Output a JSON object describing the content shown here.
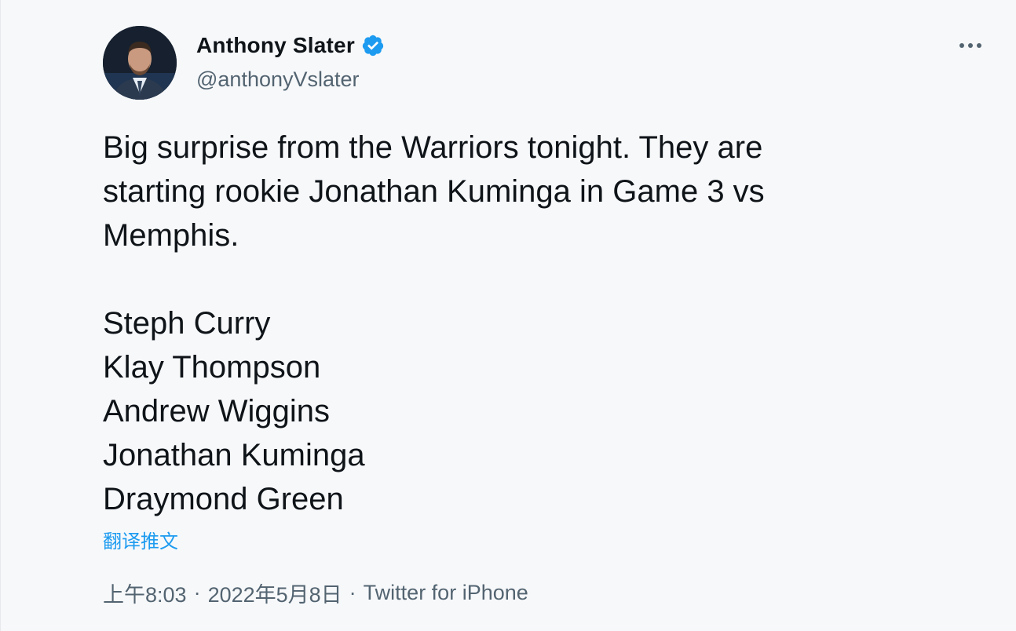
{
  "author": {
    "display_name": "Anthony Slater",
    "handle": "@anthonyVslater",
    "verified_icon": "verified-badge-icon",
    "avatar_icon": "profile-avatar"
  },
  "more_icon": "more-options-icon",
  "tweet": {
    "intro_lines": [
      "Big surprise from the Warriors tonight. They are",
      "starting rookie Jonathan Kuminga in Game 3 vs",
      "Memphis."
    ],
    "lineup": [
      "Steph Curry",
      "Klay Thompson",
      "Andrew Wiggins",
      "Jonathan Kuminga",
      "Draymond Green"
    ]
  },
  "translate_label": "翻译推文",
  "meta": {
    "time": "上午8:03",
    "separator": "·",
    "date": "2022年5月8日",
    "source": "Twitter for iPhone"
  },
  "colors": {
    "accent": "#1d9bf0",
    "text": "#0f1419",
    "secondary": "#536471",
    "background": "#f7f8fa"
  }
}
